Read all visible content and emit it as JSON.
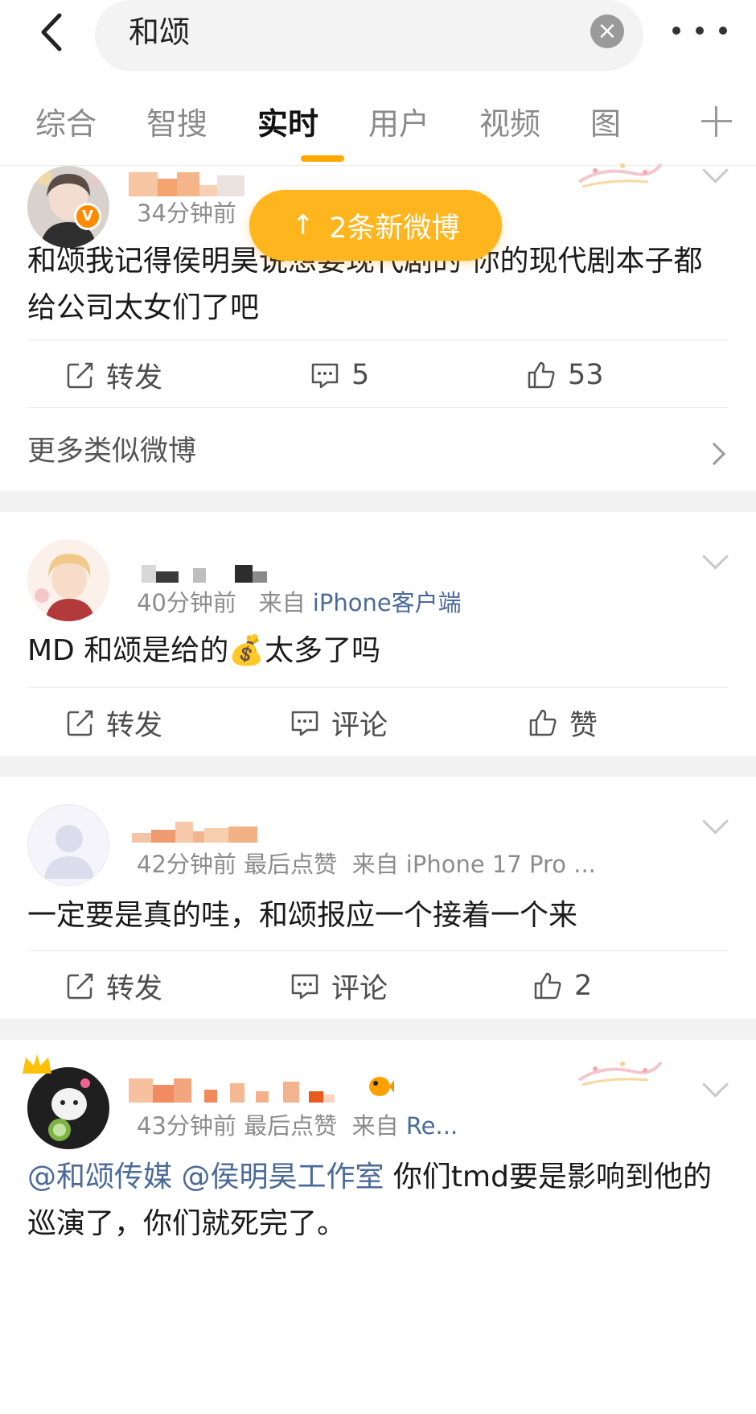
{
  "search": {
    "query": "和颂",
    "clear_icon": "clear-icon"
  },
  "tabs": [
    {
      "label": "综合"
    },
    {
      "label": "智搜"
    },
    {
      "label": "实时"
    },
    {
      "label": "用户"
    },
    {
      "label": "视频"
    },
    {
      "label": "图"
    }
  ],
  "active_tab": "实时",
  "new_posts_pill": {
    "label": "2条新微博"
  },
  "posts": [
    {
      "time": "34分钟前",
      "content": "和颂我记得侯明昊说想要现代剧的  你的现代剧本子都给公司太女们了吧",
      "actions": {
        "repost": "转发",
        "comment": "5",
        "like": "53"
      }
    },
    {
      "time": "40分钟前",
      "source_prefix": "来自",
      "source": "iPhone客户端",
      "content_before": "MD 和颂是给的",
      "emoji": "💰",
      "content_after": "太多了吗",
      "actions": {
        "repost": "转发",
        "comment": "评论",
        "like": "赞"
      }
    },
    {
      "time": "42分钟前",
      "extra": "最后点赞",
      "source": "来自 iPhone 17 Pro ...",
      "content": "一定要是真的哇，和颂报应一个接着一个来",
      "actions": {
        "repost": "转发",
        "comment": "评论",
        "like": "2"
      }
    },
    {
      "time": "43分钟前",
      "extra": "最后点赞",
      "source_prefix": "来自",
      "source": "Re...",
      "mention1": "@和颂传媒",
      "mention2": "@侯明昊工作室",
      "content": " 你们tmd要是影响到他的巡演了，你们就死完了。"
    }
  ],
  "more_similar": "更多类似微博",
  "colors": {
    "accent": "#ffa800",
    "pill": "#ffb51d",
    "link": "#4a6a9a",
    "separator": "#f2f2f2"
  }
}
